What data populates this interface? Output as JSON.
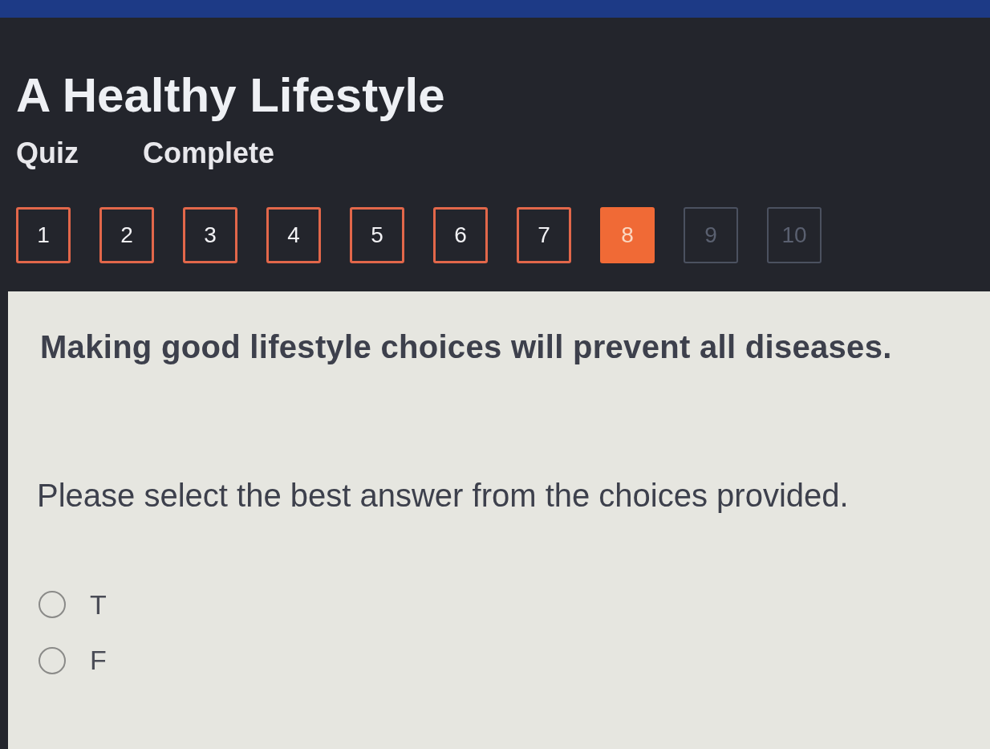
{
  "header": {
    "title": "A Healthy Lifestyle",
    "quiz_label": "Quiz",
    "status": "Complete"
  },
  "question_nav": [
    {
      "label": "1",
      "selected": false,
      "answered": true
    },
    {
      "label": "2",
      "selected": false,
      "answered": true
    },
    {
      "label": "3",
      "selected": false,
      "answered": true
    },
    {
      "label": "4",
      "selected": false,
      "answered": true
    },
    {
      "label": "5",
      "selected": false,
      "answered": true
    },
    {
      "label": "6",
      "selected": false,
      "answered": true
    },
    {
      "label": "7",
      "selected": false,
      "answered": true
    },
    {
      "label": "8",
      "selected": true,
      "answered": false
    },
    {
      "label": "9",
      "selected": false,
      "answered": false
    },
    {
      "label": "10",
      "selected": false,
      "answered": false
    }
  ],
  "question": {
    "text": "Making good lifestyle choices will prevent all diseases.",
    "instruction": "Please select the best answer from the choices provided.",
    "options": [
      {
        "label": "T",
        "selected": false
      },
      {
        "label": "F",
        "selected": false
      }
    ]
  }
}
